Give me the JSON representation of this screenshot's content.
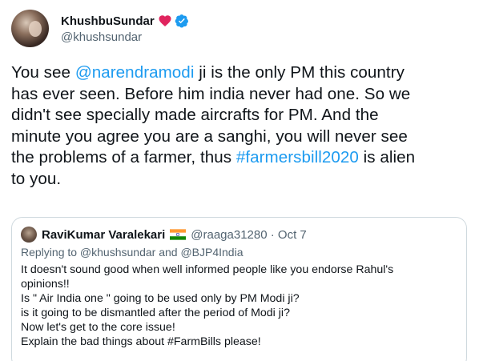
{
  "tweet": {
    "display_name": "KhushbuSundar",
    "handle": "@khushsundar",
    "icons": {
      "heart": "red-heart-icon",
      "verified": "verified-badge-icon"
    },
    "text_parts": [
      "You see ",
      "@narendramodi",
      " ji is the only PM this country\nhas ever seen. Before him india never had one. So we\ndidn't see specially made aircrafts for PM. And the\nminute you agree you are a sanghi, you will never see\nthe problems of a farmer, thus ",
      "#farmersbill2020",
      " is alien\nto you."
    ]
  },
  "quote": {
    "display_name": "RaviKumar Varalekari",
    "flag": "india-flag-icon",
    "handle": "@raaga31280",
    "separator": " · ",
    "date": "Oct 7",
    "replying_to": "Replying to @khushsundar and @BJP4India",
    "body_lines": [
      "It doesn't sound good when well informed people like you endorse Rahul's",
      "opinions!!",
      "Is \" Air India one \" going to be used only by PM Modi ji?",
      "is it going to be dismantled after the period of Modi ji?",
      "Now let's get to the core issue!",
      "Explain the bad things about #FarmBills please!"
    ]
  },
  "colors": {
    "text": "#0f1419",
    "secondary": "#536471",
    "link": "#1d9bf0",
    "border": "#cfd9de",
    "heart": "#e0245e"
  }
}
